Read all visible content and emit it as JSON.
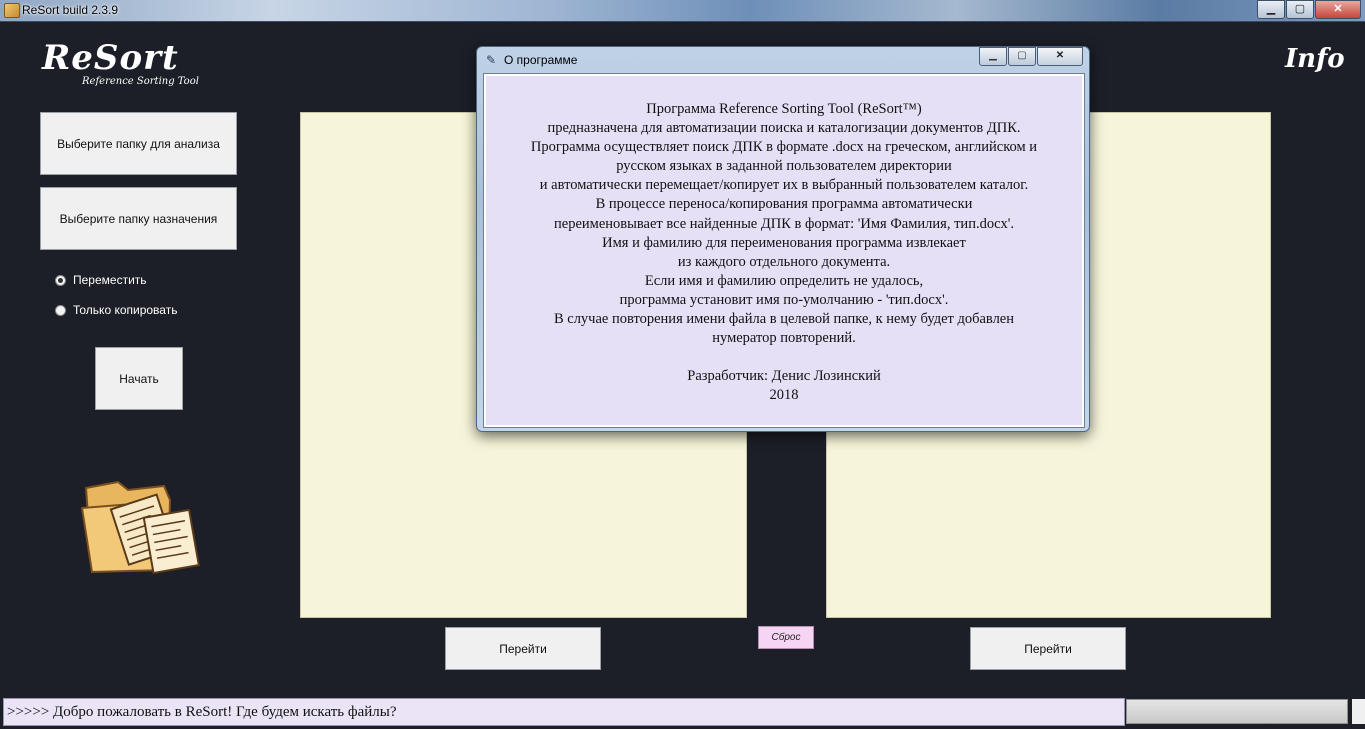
{
  "window": {
    "title": "ReSort build 2.3.9",
    "minimize": "▁",
    "maximize": "▢",
    "close": "✕"
  },
  "logo": {
    "title": "ReSort",
    "subtitle": "Reference Sorting Tool"
  },
  "info_label": "Info",
  "left": {
    "select_source": "Выберите папку для анализа",
    "select_dest": "Выберите папку назначения",
    "radio_move": "Переместить",
    "radio_copy": "Только копировать",
    "radio_selected": "move",
    "start": "Начать"
  },
  "bottom": {
    "goto_left": "Перейти",
    "reset": "Сброс",
    "goto_right": "Перейти"
  },
  "status": {
    "message": ">>>>> Добро пожаловать в ReSort! Где будем искать файлы?"
  },
  "dialog": {
    "title": "О программе",
    "minimize": "▁",
    "maximize": "▢",
    "close": "✕",
    "text": "Программа Reference Sorting Tool (ReSort™)\nпредназначена для автоматизации поиска и каталогизации документов ДПК.\nПрограмма осуществляет поиск ДПК в формате .docx на греческом, английском и\nрусском языках в заданной пользователем директории\nи автоматически перемещает/копирует их в выбранный пользователем каталог.\nВ процессе переноса/копирования программа автоматически\nпереименовывает все найденные ДПК в формат: 'Имя Фамилия, тип.docx'.\nИмя и фамилию для переименования программа извлекает\nиз каждого отдельного документа.\nЕсли имя и фамилию определить не удалось,\nпрограмма установит имя по-умолчанию - 'тип.docx'.\nВ случае повторения имени файла в целевой папке, к нему будет добавлен\nнумератор повторений.",
    "developer": "Разработчик: Денис Лозинский",
    "year": "2018"
  },
  "colors": {
    "background": "#1c1f27",
    "panel": "#f7f5d9",
    "dialog_body": "#e6e0f7",
    "reset_button": "#f6d5f4",
    "status_bar": "#ebe4f7"
  }
}
